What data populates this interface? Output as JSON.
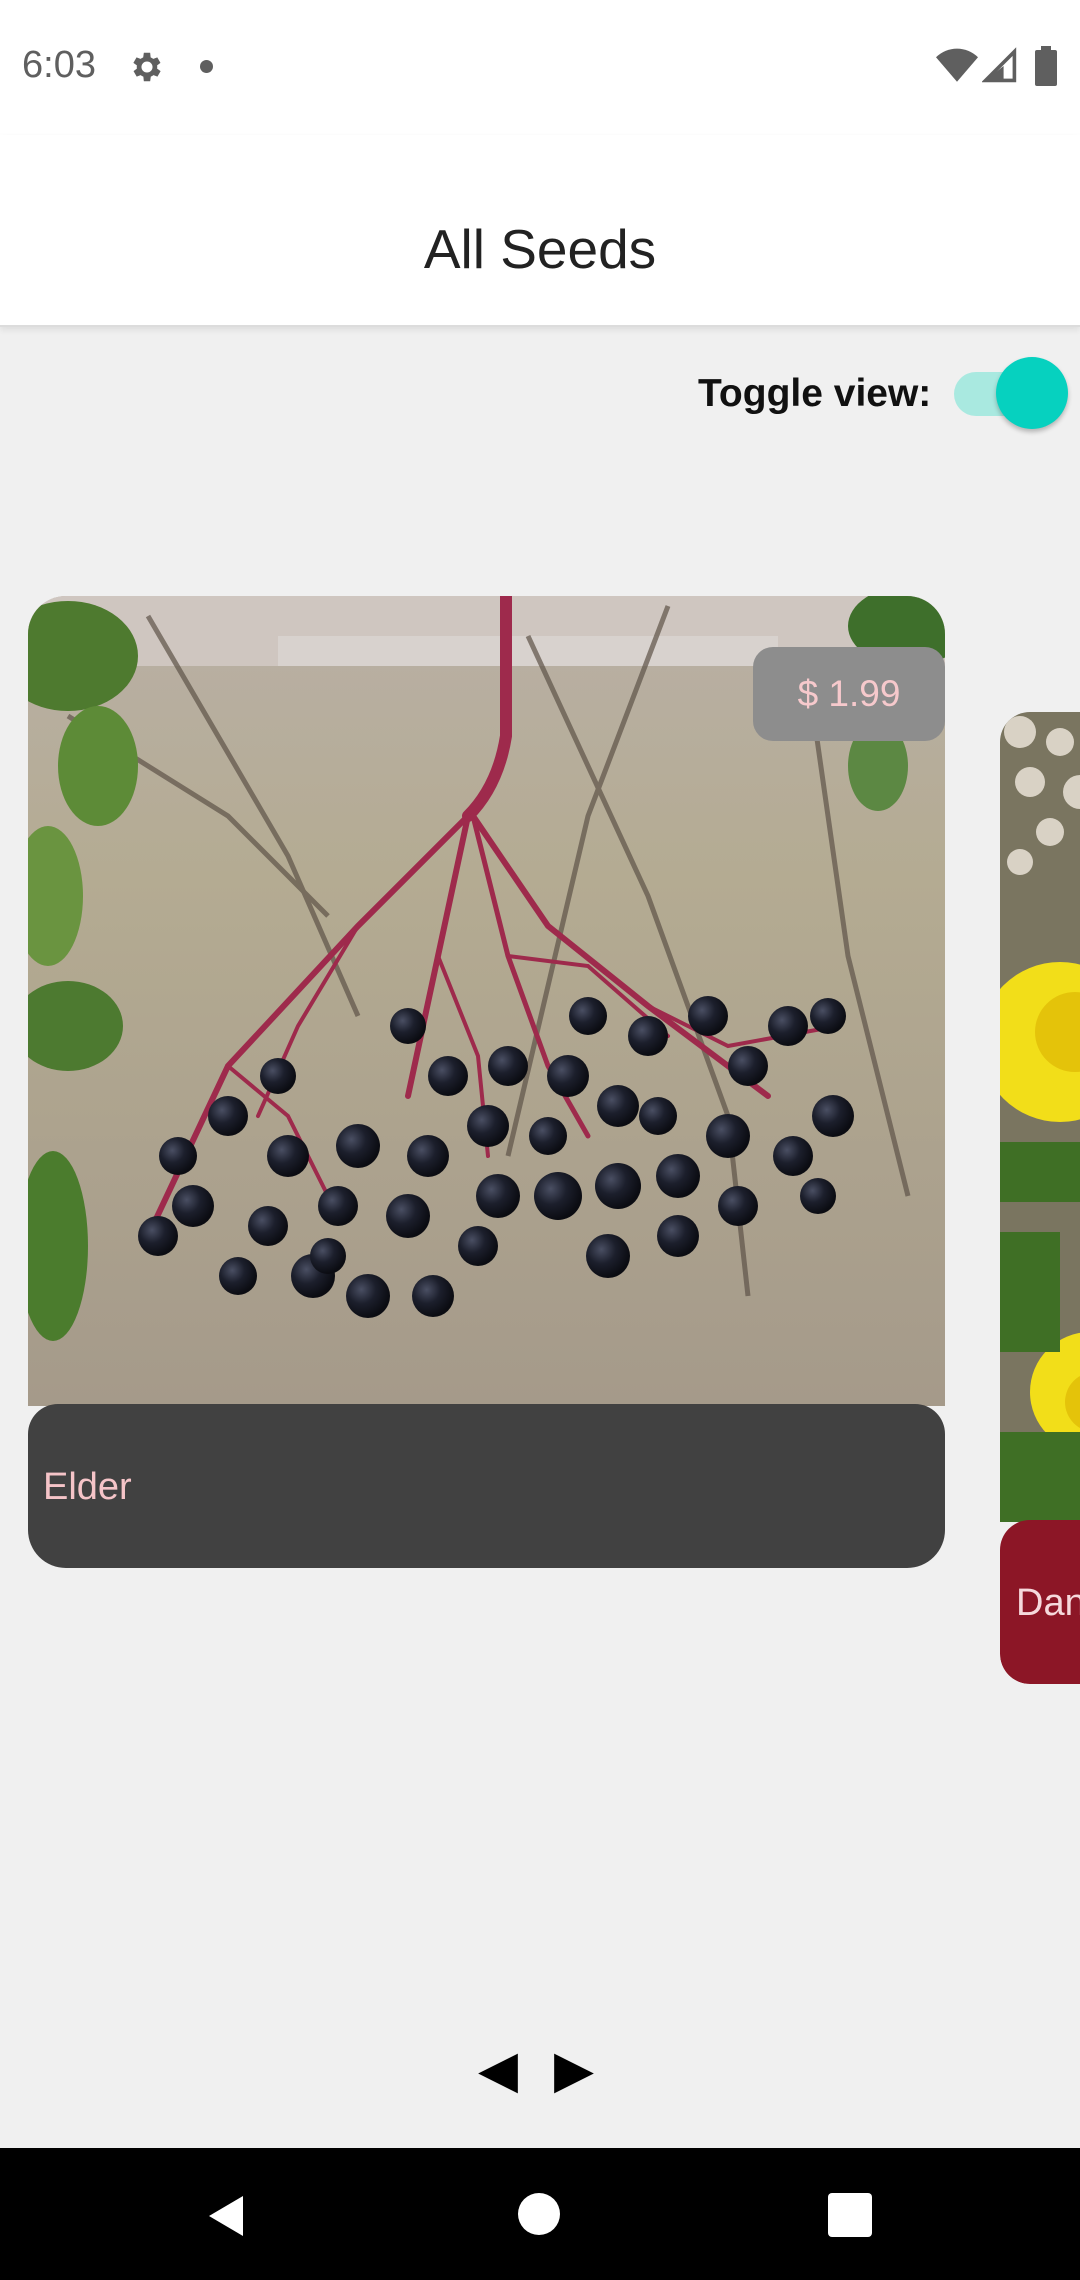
{
  "status_bar": {
    "time": "6:03",
    "icons": [
      "gear-icon",
      "notification-dot-icon",
      "wifi-icon",
      "cell-signal-icon",
      "battery-icon"
    ]
  },
  "app_bar": {
    "title": "All Seeds"
  },
  "toggle": {
    "label": "Toggle view:",
    "checked": true,
    "color": "#06d1bf"
  },
  "cards": [
    {
      "name": "Elder",
      "price": "$ 1.99",
      "footer_color": "#414141"
    },
    {
      "name": "Dan",
      "footer_color": "#8c1626"
    }
  ],
  "pager": {
    "prev_icon": "◀",
    "next_icon": "▶"
  },
  "nav_bar": {
    "buttons": [
      "back-icon",
      "home-icon",
      "recents-icon"
    ]
  }
}
